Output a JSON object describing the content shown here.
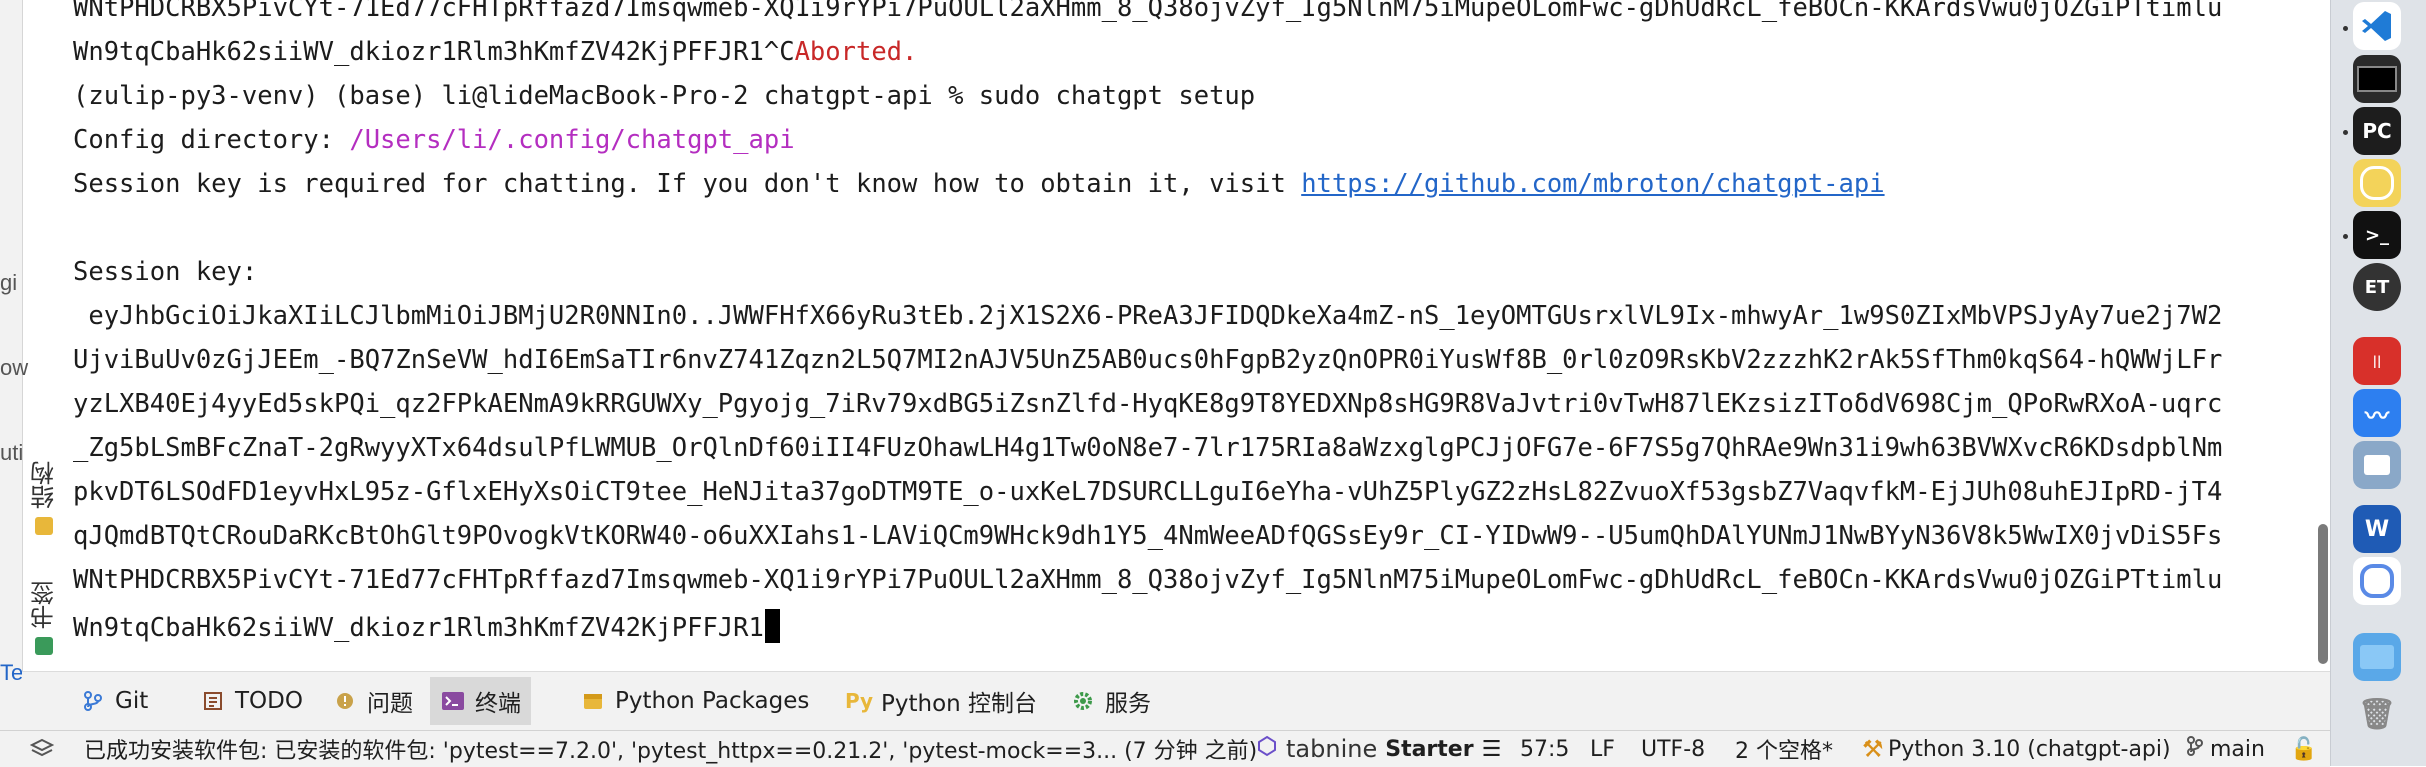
{
  "terminal": {
    "lines": [
      {
        "text": "WNtPHDCRBX5PivCYt-71Ed77cFHTpRffazd7Imsqwmeb-XQ1i9rYPi7PuOULl2aXHmm_8_Q38ojvZyf_Ig5NlnM75iMupeOLomFwc-gDhUdRcL_feBOCn-KKArdsVwu0jOZGiPTtimlu"
      },
      {
        "text": "Wn9tqCbaHk62siiWV_dkiozr1Rlm3hKmfZV42KjPFFJR1^C",
        "error": "Aborted."
      },
      {
        "text": "(zulip-py3-venv) (base) li@lideMacBook-Pro-2 chatgpt-api % sudo chatgpt setup"
      },
      {
        "text": "Config directory: ",
        "path": "/Users/li/.config/chatgpt_api"
      },
      {
        "text": "Session key is required for chatting. If you don't know how to obtain it, visit ",
        "link": "https://github.com/mbroton/chatgpt-api"
      },
      {
        "text": ""
      },
      {
        "text": "Session key:"
      },
      {
        "text": " eyJhbGciOiJkaXIiLCJlbmMiOiJBMjU2R0NNIn0..JWWFHfX66yRu3tEb.2jX1S2X6-PReA3JFIDQDkeXa4mZ-nS_1eyOMTGUsrxlVL9Ix-mhwyAr_1w9S0ZIxMbVPSJyAy7ue2j7W2"
      },
      {
        "text": "UjviBuUv0zGjJEEm_-BQ7ZnSeVW_hdI6EmSaTIr6nvZ741Zqzn2L5Q7MI2nAJV5UnZ5AB0ucs0hFgpB2yzQnOPR0iYusWf8B_0rl0zO9RsKbV2zzzhK2rAk5SfThm0kqS64-hQWWjLFr"
      },
      {
        "text": "yzLXB40Ej4yyEd5skPQi_qz2FPkAENmA9kRRGUWXy_Pgyojg_7iRv79xdBG5iZsnZlfd-HyqKE8g9T8YEDXNp8sHG9R8VaJvtri0vTwH87lEKzsizIToδdV698Cjm_QPoRwRXoA-uqrc"
      },
      {
        "text": "_Zg5bLSmBFcZnaT-2gRwyyXTx64dsulPfLWMUB_OrQlnDf60iII4FUzOhawLH4g1Tw0oN8e7-7lr175RIa8aWzxglgPCJjOFG7e-6F7S5g7QhRAe9Wn31i9wh63BVWXvcR6KDsdpblNm"
      },
      {
        "text": "pkvDT6LSOdFD1eyvHxL95z-GflxEHyXsOiCT9tee_HeNJita37goDTM9TE_o-uxKeL7DSURCLLguI6eYha-vUhZ5PlyGZ2zHsL82ZvuoXf53gsbZ7VaqvfkM-EjJUh08uhEJIpRD-jT4"
      },
      {
        "text": "qJQmdBTQtCRouDaRKcBtOhGlt9POvogkVtKORW40-o6uXXIahs1-LAViQCm9WHck9dh1Y5_4NmWeeADfQGSsEy9r_CI-YIDwW9--U5umQhDAlYUNmJ1NwBYyN36V8k5WwIX0jvDiS5Fs"
      },
      {
        "text": "WNtPHDCRBX5PivCYt-71Ed77cFHTpRffazd7Imsqwmeb-XQ1i9rYPi7PuOULl2aXHmm_8_Q38ojvZyf_Ig5NlnM75iMupeOLomFwc-gDhUdRcL_feBOCn-KKArdsVwu0jOZGiPTtimlu"
      },
      {
        "text": "Wn9tqCbaHk62siiWV_dkiozr1Rlm3hKmfZV42KjPFFJR1"
      }
    ]
  },
  "left_panel": {
    "peek_texts": [
      "gi",
      "ow",
      "uti",
      "Te"
    ],
    "structure_label": "结构",
    "bookmarks_label": "书签"
  },
  "tool_tabs": [
    {
      "label": "Git",
      "icon": "git-branch-icon"
    },
    {
      "label": "TODO",
      "icon": "todo-list-icon"
    },
    {
      "label": "问题",
      "icon": "problems-icon"
    },
    {
      "label": "终端",
      "icon": "terminal-icon",
      "active": true
    },
    {
      "label": "Python Packages",
      "icon": "packages-icon"
    },
    {
      "label": "Python 控制台",
      "icon": "python-console-icon"
    },
    {
      "label": "服务",
      "icon": "services-icon"
    }
  ],
  "status_bar": {
    "message": "已成功安装软件包: 已安装的软件包: 'pytest==7.2.0', 'pytest_httpx==0.21.2', 'pytest-mock==3... (7 分钟 之前)",
    "tabnine": "tabnine",
    "tabnine_plan": "Starter",
    "position": "57:5",
    "line_ending": "LF",
    "encoding": "UTF-8",
    "indent": "2 个空格*",
    "interpreter": "Python 3.10 (chatgpt-api)",
    "branch": "main",
    "overflow_text": "r 3.1"
  },
  "dock_icons": [
    "vscode",
    "screen",
    "pycharm",
    "notes",
    "terminal",
    "et",
    "parallels",
    "messenger",
    "preview",
    "word",
    "screenshot",
    "folder",
    "trash"
  ],
  "colors": {
    "error": "#c82828",
    "path": "#b42ec0",
    "link": "#2366c8",
    "panel_bg": "#f2f2f2"
  }
}
